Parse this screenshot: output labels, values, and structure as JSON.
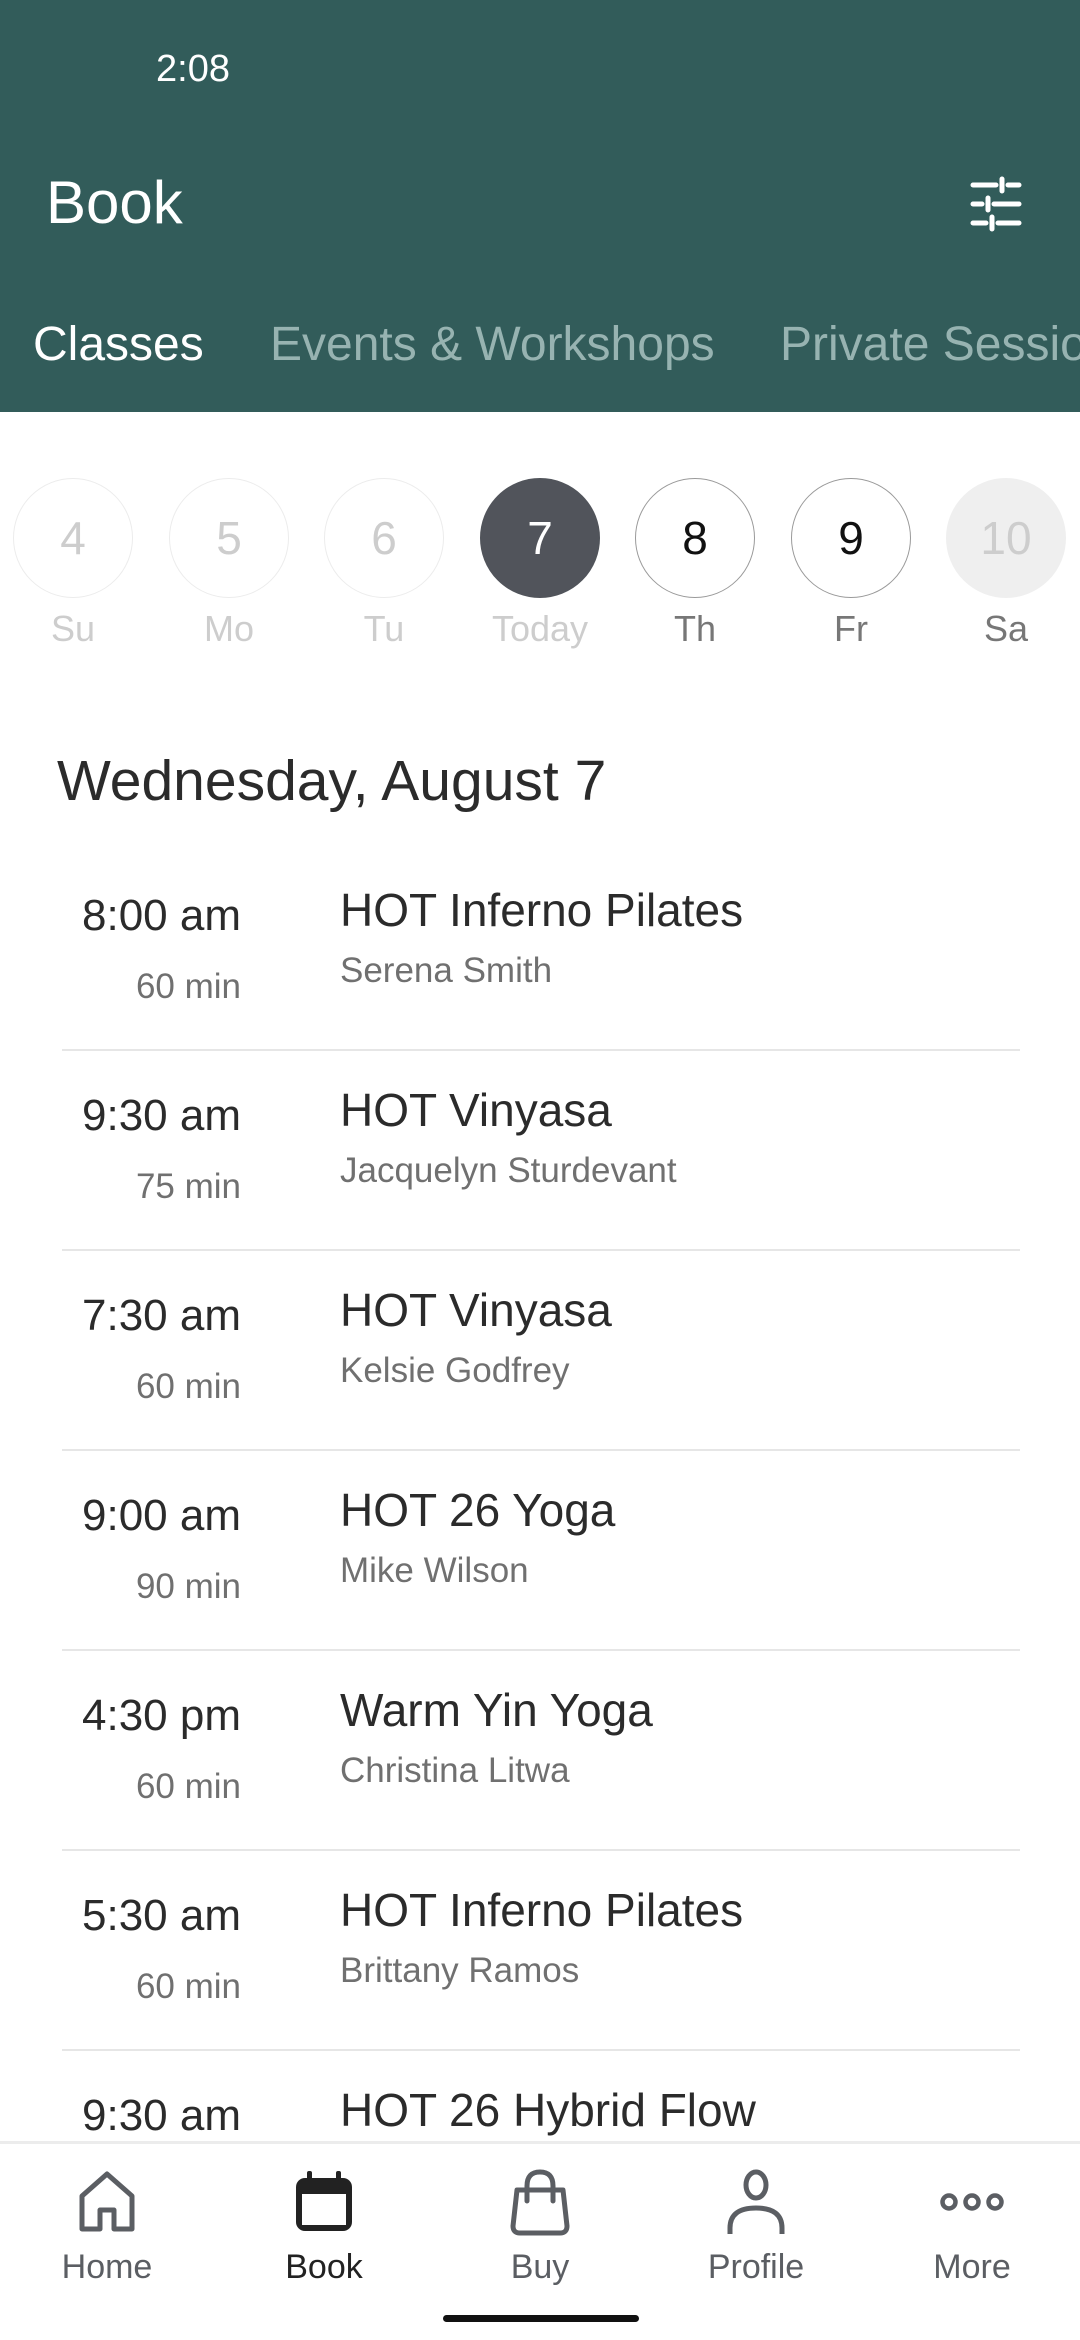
{
  "status_bar": {
    "time": "2:08"
  },
  "header": {
    "title": "Book",
    "filter_icon": "sliders-icon"
  },
  "tabs": [
    {
      "label": "Classes",
      "active": true
    },
    {
      "label": "Events & Workshops",
      "active": false
    },
    {
      "label": "Private Sessions",
      "active": false
    }
  ],
  "date_strip": [
    {
      "day": "4",
      "label": "Su",
      "state": "past"
    },
    {
      "day": "5",
      "label": "Mo",
      "state": "past"
    },
    {
      "day": "6",
      "label": "Tu",
      "state": "past"
    },
    {
      "day": "7",
      "label": "Today",
      "state": "selected"
    },
    {
      "day": "8",
      "label": "Th",
      "state": "upcoming"
    },
    {
      "day": "9",
      "label": "Fr",
      "state": "upcoming"
    },
    {
      "day": "10",
      "label": "Sa",
      "state": "disabled"
    }
  ],
  "date_heading": "Wednesday, August 7",
  "classes": [
    {
      "time": "8:00 am",
      "duration": "60 min",
      "name": "HOT Inferno Pilates",
      "instructor": "Serena Smith"
    },
    {
      "time": "9:30 am",
      "duration": "75 min",
      "name": "HOT Vinyasa",
      "instructor": "Jacquelyn Sturdevant"
    },
    {
      "time": "7:30 am",
      "duration": "60 min",
      "name": "HOT Vinyasa",
      "instructor": "Kelsie Godfrey"
    },
    {
      "time": "9:00 am",
      "duration": "90 min",
      "name": "HOT 26 Yoga",
      "instructor": "Mike Wilson"
    },
    {
      "time": "4:30 pm",
      "duration": "60 min",
      "name": "Warm Yin Yoga",
      "instructor": "Christina Litwa"
    },
    {
      "time": "5:30 am",
      "duration": "60 min",
      "name": "HOT Inferno Pilates",
      "instructor": "Brittany Ramos"
    },
    {
      "time": "9:30 am",
      "duration": "",
      "name": "HOT 26 Hybrid Flow",
      "instructor": ""
    }
  ],
  "bottom_nav": [
    {
      "label": "Home",
      "icon": "home-icon",
      "active": false
    },
    {
      "label": "Book",
      "icon": "calendar-icon",
      "active": true
    },
    {
      "label": "Buy",
      "icon": "shopping-bag-icon",
      "active": false
    },
    {
      "label": "Profile",
      "icon": "person-icon",
      "active": false
    },
    {
      "label": "More",
      "icon": "more-dots-icon",
      "active": false
    }
  ],
  "colors": {
    "header_bg": "#325c5a",
    "tab_inactive": "#97b3b1",
    "selected_day_bg": "#51545b"
  }
}
